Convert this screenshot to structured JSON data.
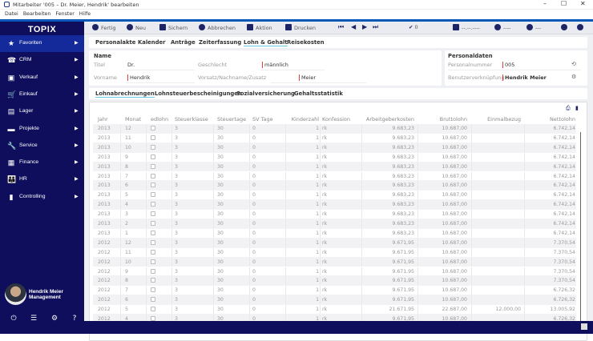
{
  "window": {
    "title": "Mitarbeiter '005 – Dr. Meier, Hendrik' bearbeiten",
    "min": "–",
    "max": "☐",
    "close": "✕"
  },
  "menu": [
    "Datei",
    "Bearbeiten",
    "Fenster",
    "Hilfe"
  ],
  "sidebar": {
    "logo": "TOPIX",
    "items": [
      {
        "label": "Favoriten",
        "icon": "★",
        "name": "star-icon"
      },
      {
        "label": "CRM",
        "icon": "☎",
        "name": "crm-icon"
      },
      {
        "label": "Verkauf",
        "icon": "▣",
        "name": "sales-icon"
      },
      {
        "label": "Einkauf",
        "icon": "🛒",
        "name": "cart-icon"
      },
      {
        "label": "Lager",
        "icon": "▤",
        "name": "warehouse-icon"
      },
      {
        "label": "Projekte",
        "icon": "▬",
        "name": "projects-icon"
      },
      {
        "label": "Service",
        "icon": "🔧",
        "name": "wrench-icon"
      },
      {
        "label": "Finance",
        "icon": "▦",
        "name": "finance-icon"
      },
      {
        "label": "HR",
        "icon": "👪",
        "name": "people-icon"
      },
      {
        "label": "Controlling",
        "icon": "▮",
        "name": "chart-icon"
      }
    ],
    "user": {
      "name": "Hendrik Meier",
      "role": "Management"
    },
    "bottom_icons": [
      "⏻",
      "☰",
      "⚙",
      "?"
    ]
  },
  "toolbar": {
    "fertig": "Fertig",
    "neu": "Neu",
    "sichern": "Sichern",
    "abbrechen": "Abbrechen",
    "aktion": "Aktion",
    "drucken": "Drucken",
    "check_count": "0",
    "date": "--.--.----",
    "user1": "----",
    "user2": "---"
  },
  "tabs": [
    "Personalakte",
    "Kalender",
    "Anträge",
    "Zeiterfassung",
    "Lohn & Gehalt",
    "Reisekosten"
  ],
  "active_tab": "Lohn & Gehalt",
  "name_panel": {
    "heading": "Name",
    "titel_label": "Titel",
    "titel": "Dr.",
    "geschlecht_label": "Geschlecht",
    "geschlecht": "männlich",
    "vorname_label": "Vorname",
    "vorname": "Hendrik",
    "nachname_label": "Vorsatz/Nachname/Zusatz",
    "nachname": "Meier"
  },
  "personal_panel": {
    "heading": "Personaldaten",
    "nummer_label": "Personalnummer",
    "nummer": "005",
    "benutzer_label": "Benutzerverknüpfung",
    "benutzer": "Hendrik Meier"
  },
  "subtabs": [
    "Lohnabrechnungen",
    "Lohnsteuerbescheinigungen",
    "Sozialversicherung",
    "Gehaltsstatistik"
  ],
  "active_subtab": "Lohnabrechnungen",
  "table": {
    "columns": [
      "Jahr",
      "Monat",
      "edlohn",
      "Steuerklasse",
      "Steuertage",
      "SV Tage",
      "Kinderzahl",
      "Konfession",
      "Arbeitgeberkosten",
      "Bruttolohn",
      "Einmalbezug",
      "Nettolohn"
    ],
    "rows": [
      [
        "2013",
        "12",
        "",
        "3",
        "30",
        "0",
        "1",
        "rk",
        "9.683,23",
        "10.687,00",
        "",
        "6.742,14"
      ],
      [
        "2013",
        "11",
        "",
        "3",
        "30",
        "0",
        "1",
        "rk",
        "9.683,23",
        "10.687,00",
        "",
        "6.742,14"
      ],
      [
        "2013",
        "10",
        "",
        "3",
        "30",
        "0",
        "1",
        "rk",
        "9.683,23",
        "10.687,00",
        "",
        "6.742,14"
      ],
      [
        "2013",
        "9",
        "",
        "3",
        "30",
        "0",
        "1",
        "rk",
        "9.683,23",
        "10.687,00",
        "",
        "6.742,14"
      ],
      [
        "2013",
        "8",
        "",
        "3",
        "30",
        "0",
        "1",
        "rk",
        "9.683,23",
        "10.687,00",
        "",
        "6.742,14"
      ],
      [
        "2013",
        "7",
        "",
        "3",
        "30",
        "0",
        "1",
        "rk",
        "9.683,23",
        "10.687,00",
        "",
        "6.742,14"
      ],
      [
        "2013",
        "6",
        "",
        "3",
        "30",
        "0",
        "1",
        "rk",
        "9.683,23",
        "10.687,00",
        "",
        "6.742,14"
      ],
      [
        "2013",
        "5",
        "",
        "3",
        "30",
        "0",
        "1",
        "rk",
        "9.683,23",
        "10.687,00",
        "",
        "6.742,14"
      ],
      [
        "2013",
        "4",
        "",
        "3",
        "30",
        "0",
        "1",
        "rk",
        "9.683,23",
        "10.687,00",
        "",
        "6.742,14"
      ],
      [
        "2013",
        "3",
        "",
        "3",
        "30",
        "0",
        "1",
        "rk",
        "9.683,23",
        "10.687,00",
        "",
        "6.742,14"
      ],
      [
        "2013",
        "2",
        "",
        "3",
        "30",
        "0",
        "1",
        "rk",
        "9.683,23",
        "10.687,00",
        "",
        "6.742,14"
      ],
      [
        "2013",
        "1",
        "",
        "3",
        "30",
        "0",
        "1",
        "rk",
        "9.683,23",
        "10.687,00",
        "",
        "6.742,14"
      ],
      [
        "2012",
        "12",
        "",
        "3",
        "30",
        "0",
        "1",
        "rk",
        "9.671,95",
        "10.687,00",
        "",
        "7.370,54"
      ],
      [
        "2012",
        "11",
        "",
        "3",
        "30",
        "0",
        "1",
        "rk",
        "9.671,95",
        "10.687,00",
        "",
        "7.370,54"
      ],
      [
        "2012",
        "10",
        "",
        "3",
        "30",
        "0",
        "1",
        "rk",
        "9.671,95",
        "10.687,00",
        "",
        "7.370,54"
      ],
      [
        "2012",
        "9",
        "",
        "3",
        "30",
        "0",
        "1",
        "rk",
        "9.671,95",
        "10.687,00",
        "",
        "7.370,54"
      ],
      [
        "2012",
        "8",
        "",
        "3",
        "30",
        "0",
        "1",
        "rk",
        "9.671,95",
        "10.687,00",
        "",
        "7.370,54"
      ],
      [
        "2012",
        "7",
        "",
        "3",
        "30",
        "0",
        "1",
        "rk",
        "9.671,95",
        "10.687,00",
        "",
        "6.726,32"
      ],
      [
        "2012",
        "6",
        "",
        "3",
        "30",
        "0",
        "1",
        "rk",
        "9.671,95",
        "10.687,00",
        "",
        "6.726,32"
      ],
      [
        "2012",
        "5",
        "",
        "3",
        "30",
        "0",
        "1",
        "rk",
        "21.671,95",
        "22.687,00",
        "12.000,00",
        "13.005,92"
      ],
      [
        "2012",
        "4",
        "",
        "3",
        "30",
        "0",
        "1",
        "rk",
        "9.671,95",
        "10.687,00",
        "",
        "6.726,32"
      ]
    ]
  }
}
